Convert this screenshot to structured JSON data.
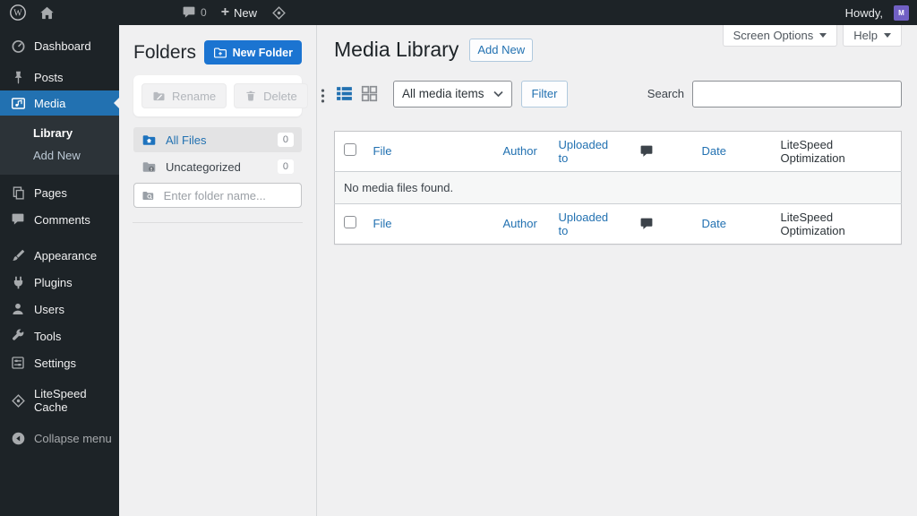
{
  "admin_bar": {
    "comments_count": "0",
    "new_label": "New",
    "howdy": "Howdy,",
    "avatar_letter": "M"
  },
  "sidebar": {
    "items": [
      {
        "label": "Dashboard"
      },
      {
        "label": "Posts"
      },
      {
        "label": "Media"
      },
      {
        "label": "Pages"
      },
      {
        "label": "Comments"
      },
      {
        "label": "Appearance"
      },
      {
        "label": "Plugins"
      },
      {
        "label": "Users"
      },
      {
        "label": "Tools"
      },
      {
        "label": "Settings"
      },
      {
        "label": "LiteSpeed Cache"
      },
      {
        "label": "Collapse menu"
      }
    ],
    "submenu": [
      {
        "label": "Library"
      },
      {
        "label": "Add New"
      }
    ]
  },
  "folders_panel": {
    "title": "Folders",
    "new_folder_button": "New Folder",
    "rename_button": "Rename",
    "delete_button": "Delete",
    "folders": [
      {
        "name": "All Files",
        "count": "0"
      },
      {
        "name": "Uncategorized",
        "count": "0"
      }
    ],
    "input_placeholder": "Enter folder name..."
  },
  "main": {
    "title": "Media Library",
    "add_new_button": "Add New",
    "screen_options_button": "Screen Options",
    "help_button": "Help",
    "media_filter": {
      "selected_option": "All media items",
      "filter_button": "Filter"
    },
    "search_label": "Search",
    "table": {
      "columns": [
        "File",
        "Author",
        "Uploaded to",
        "Date",
        "LiteSpeed Optimization"
      ],
      "empty_message": "No media files found."
    }
  },
  "colors": {
    "admin_dark": "#1d2327",
    "submenu_dark": "#2c3338",
    "accent_blue": "#2271b1",
    "new_folder_blue": "#1b74d1",
    "content_bg": "#f0f0f1"
  }
}
